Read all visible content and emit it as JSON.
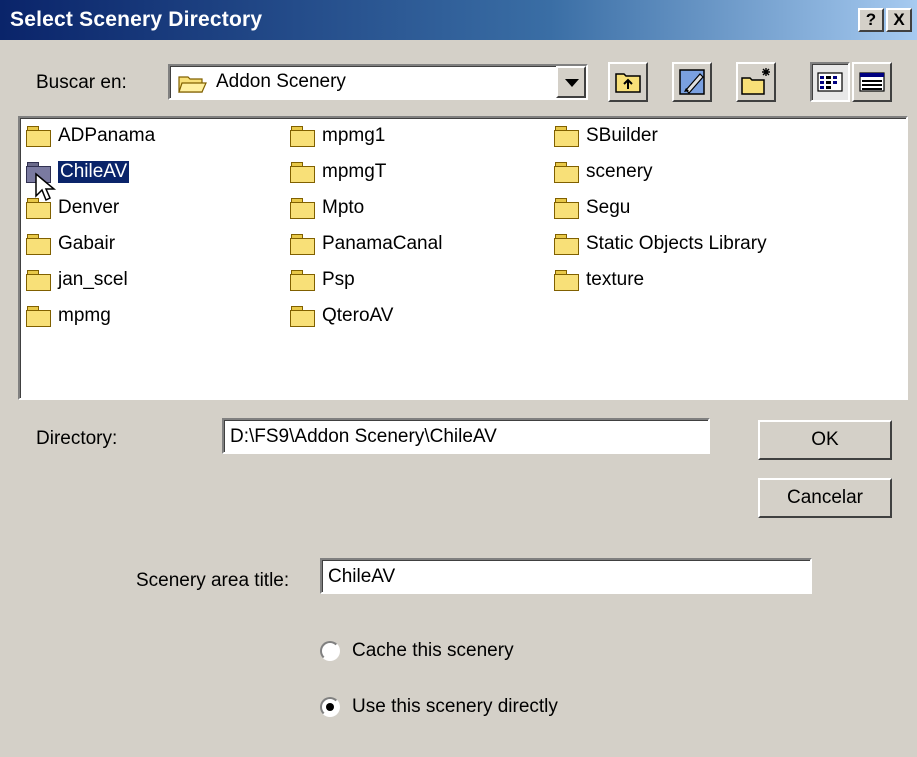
{
  "window": {
    "title": "Select Scenery Directory",
    "help_btn": "?",
    "close_btn": "X"
  },
  "lookin": {
    "label": "Buscar en:",
    "value": "Addon Scenery"
  },
  "files": {
    "col1": [
      "ADPanama",
      "ChileAV",
      "Denver",
      "Gabair",
      "jan_scel",
      "mpmg"
    ],
    "col2": [
      "mpmg1",
      "mpmgT",
      "Mpto",
      "PanamaCanal",
      "Psp",
      "QteroAV"
    ],
    "col3": [
      "SBuilder",
      "scenery",
      "Segu",
      "Static Objects Library",
      "texture"
    ],
    "selected": "ChileAV"
  },
  "directory": {
    "label": "Directory:",
    "value": "D:\\FS9\\Addon Scenery\\ChileAV"
  },
  "buttons": {
    "ok": "OK",
    "cancel": "Cancelar"
  },
  "scenery_title": {
    "label": "Scenery area title:",
    "value": "ChileAV"
  },
  "options": {
    "cache": "Cache this scenery",
    "use": "Use this scenery directly",
    "selected": "use"
  },
  "colors": {
    "title_bar": "#0a246a",
    "selection": "#0a246a",
    "face": "#d4d0c8"
  }
}
